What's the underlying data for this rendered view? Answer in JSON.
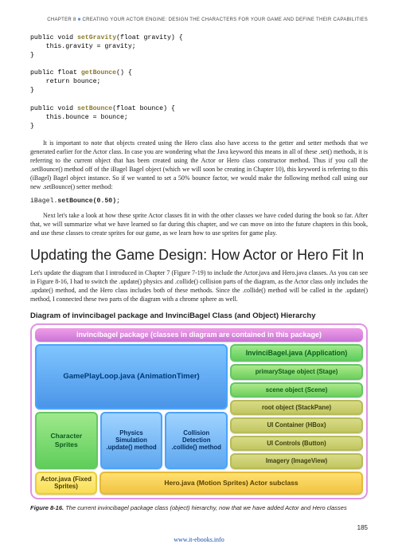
{
  "header": {
    "chapter_label": "CHAPTER 8",
    "separator": "■",
    "chapter_title": "CREATING YOUR ACTOR ENGINE: DESIGN THE CHARACTERS FOR YOUR GAME AND DEFINE THEIR CAPABILITIES"
  },
  "code": {
    "setGravity_sig_pre": "public void ",
    "setGravity_name": "setGravity",
    "setGravity_sig_post": "(float gravity) {",
    "setGravity_body": "    this.gravity = gravity;",
    "close": "}",
    "getBounce_sig_pre": "public float ",
    "getBounce_name": "getBounce",
    "getBounce_sig_post": "() {",
    "getBounce_body": "    return bounce;",
    "setBounce_sig_pre": "public void ",
    "setBounce_name": "setBounce",
    "setBounce_sig_post": "(float bounce) {",
    "setBounce_body": "    this.bounce = bounce;"
  },
  "paragraphs": {
    "p1": "It is important to note that objects created using the Hero class also have access to the getter and setter methods that we generated earlier for the Actor class. In case you are wondering what the Java keyword this means in all of these .set() methods, it is referring to the current object that has been created using the Actor or Hero class constructor method. Thus if you call the .setBounce() method off of the iBagel Bagel object (which we will soon be creating in Chapter 10), this keyword is referring to this (iBagel) Bagel object instance. So if we wanted to set a 50% bounce factor, we would make the following method call using our new .setBounce() setter method:",
    "p2": "Next let's take a look at how these sprite Actor classes fit in with the other classes we have coded during the book so far. After that, we will summarize what we have learned so far during this chapter, and we can move on into the future chapters in this book, and use these classes to create sprites for our game, as we learn how to use sprites for game play.",
    "p3": "Let's update the diagram that I introduced in Chapter 7 (Figure 7-19) to include the Actor.java and Hero.java classes. As you can see in Figure 8-16, I had to switch the .update() physics and .collide() collision parts of the diagram, as the Actor class only includes the .update() method, and the Hero class includes both of these methods. Since the .collide() method will be called in the .update() method, I connected these two parts of the diagram with a chrome sphere as well."
  },
  "inline_code": {
    "pre": "iBagel.",
    "bold": "setBounce(0.50)",
    "post": ";"
  },
  "section_heading": "Updating the Game Design: How Actor or Hero Fit In",
  "diagram_title": "Diagram of invincibagel package and InvinciBagel Class (and Object) Hierarchy",
  "diagram": {
    "pkg": "invincibagel package (classes in diagram are contained in this package)",
    "gameplayloop": "GamePlayLoop.java (AnimationTimer)",
    "invincibagel": "InvinciBagel.java (Application)",
    "primarystage": "primaryStage object (Stage)",
    "charsprites": "Character\nSprites",
    "physics": "Physics\nSimulation\n.update()\nmethod",
    "collision": "Collision\nDetection\n.collide()\nmethod",
    "scene": "scene object (Scene)",
    "root": "root object (StackPane)",
    "ui_container": "UI Container (HBox)",
    "ui_controls": "UI Controls (Button)",
    "imagery": "Imagery (ImageView)",
    "actor": "Actor.java\n(Fixed Sprites)",
    "hero": "Hero.java (Motion Sprites) Actor subclass"
  },
  "figure": {
    "number": "Figure 8-16.",
    "caption": " The current invincibagel package class (object) hierarchy, now that we have added Actor and Hero classes"
  },
  "page_number": "185",
  "footer_link": "www.it-ebooks.info"
}
